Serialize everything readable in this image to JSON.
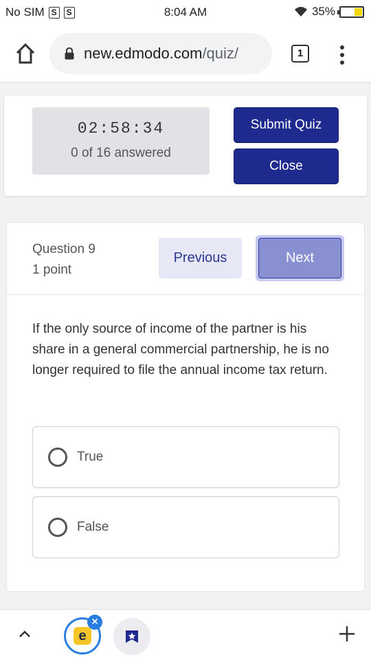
{
  "status": {
    "carrier": "No SIM",
    "sim_icons": [
      "S",
      "S"
    ],
    "time": "8:04 AM",
    "battery_percent": "35%",
    "battery_level": 0.35
  },
  "browser": {
    "url_host": "new.edmodo.com",
    "url_path": "/quiz/",
    "tab_count": "1"
  },
  "quiz": {
    "timer": "02:58:34",
    "answered": "0 of 16 answered",
    "submit_label": "Submit Quiz",
    "close_label": "Close"
  },
  "question": {
    "number": "Question 9",
    "points": "1 point",
    "prev_label": "Previous",
    "next_label": "Next",
    "text": "If the only source of income of the partner is his share in a general commercial partnership, he is no longer required to file the annual income tax return.",
    "options": [
      {
        "label": "True"
      },
      {
        "label": "False"
      }
    ]
  },
  "bottom": {
    "app_logo_letter": "e",
    "close_glyph": "×"
  }
}
